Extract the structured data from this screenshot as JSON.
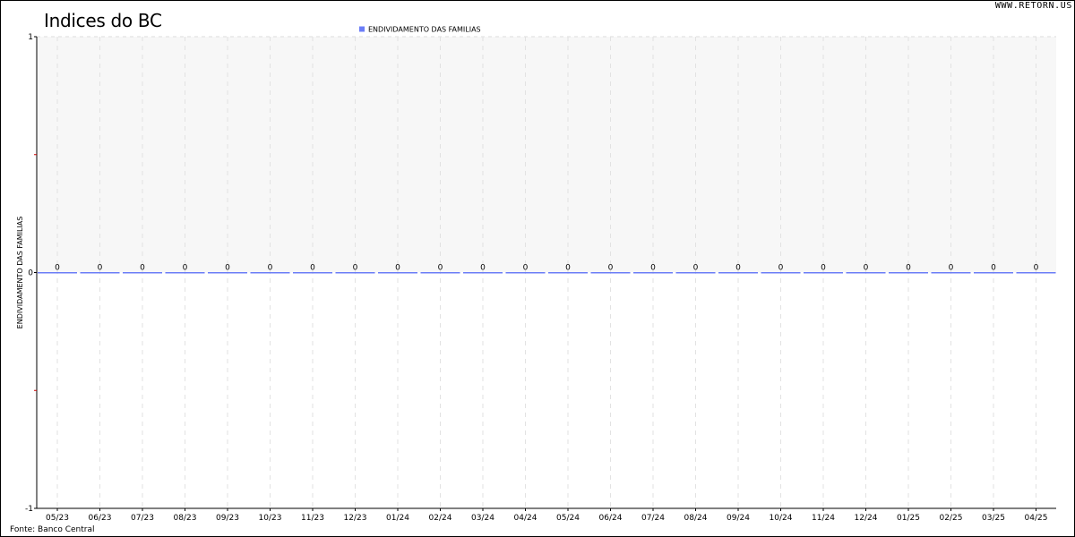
{
  "header": {
    "title": "Indices do BC",
    "site": "WWW.RETORN.US",
    "source": "Fonte: Banco Central"
  },
  "chart_data": {
    "type": "bar",
    "title": "Indices do BC",
    "xlabel": "",
    "ylabel": "ENDIVIDAMENTO DAS FAMILIAS",
    "ylim": [
      -1,
      1
    ],
    "yticks": [
      "1",
      "0",
      "-1"
    ],
    "grid": true,
    "legend_position": "top-center",
    "categories": [
      "05/23",
      "06/23",
      "07/23",
      "08/23",
      "09/23",
      "10/23",
      "11/23",
      "12/23",
      "01/24",
      "02/24",
      "03/24",
      "04/24",
      "05/24",
      "06/24",
      "07/24",
      "08/24",
      "09/24",
      "10/24",
      "11/24",
      "12/24",
      "01/25",
      "02/25",
      "03/25",
      "04/25"
    ],
    "series": [
      {
        "name": "ENDIVIDAMENTO DAS FAMILIAS",
        "color": "#6b7df7",
        "values": [
          0,
          0,
          0,
          0,
          0,
          0,
          0,
          0,
          0,
          0,
          0,
          0,
          0,
          0,
          0,
          0,
          0,
          0,
          0,
          0,
          0,
          0,
          0,
          0
        ],
        "labels": [
          "0",
          "0",
          "0",
          "0",
          "0",
          "0",
          "0",
          "0",
          "0",
          "0",
          "0",
          "0",
          "0",
          "0",
          "0",
          "0",
          "0",
          "0",
          "0",
          "0",
          "0",
          "0",
          "0",
          "0"
        ]
      }
    ]
  }
}
